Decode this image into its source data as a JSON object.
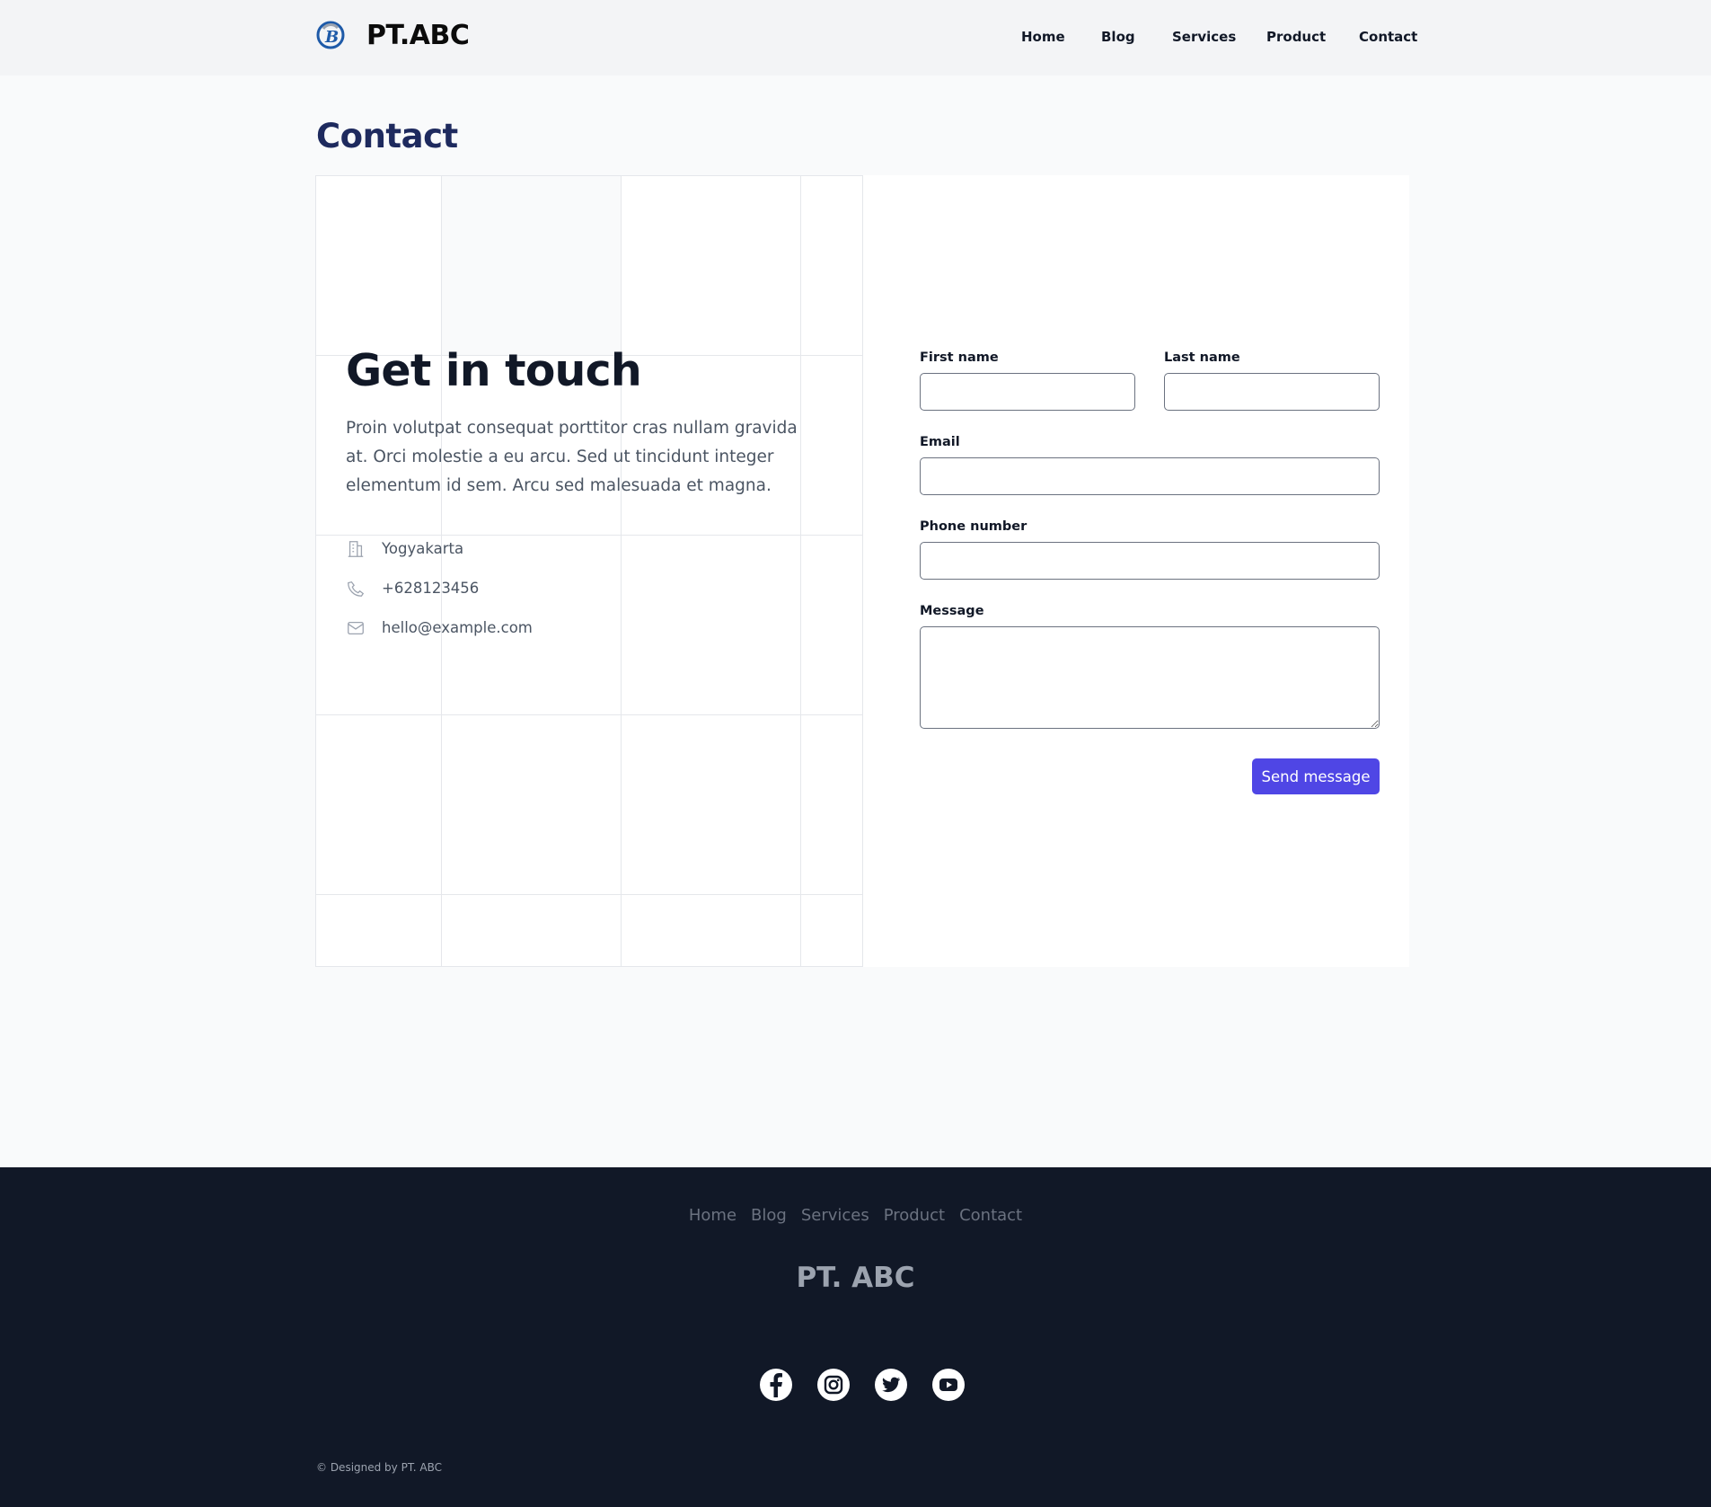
{
  "header": {
    "brand": "PT.ABC",
    "nav": [
      "Home",
      "Blog",
      "Services",
      "Product",
      "Contact"
    ]
  },
  "page": {
    "title": "Contact"
  },
  "contact_info": {
    "heading": "Get in touch",
    "body": "Proin volutpat consequat porttitor cras nullam gravida at. Orci molestie a eu arcu. Sed ut tincidunt integer elementum id sem. Arcu sed malesuada et magna.",
    "address": "Yogyakarta",
    "phone": "+628123456",
    "email": "hello@example.com",
    "icons": [
      "building-icon",
      "phone-icon",
      "envelope-icon"
    ]
  },
  "form": {
    "first_name_label": "First name",
    "first_name_value": "",
    "last_name_label": "Last name",
    "last_name_value": "",
    "email_label": "Email",
    "email_value": "",
    "phone_label": "Phone number",
    "phone_value": "",
    "message_label": "Message",
    "message_value": "",
    "submit_label": "Send message"
  },
  "footer": {
    "nav": [
      "Home",
      "Blog",
      "Services",
      "Product",
      "Contact"
    ],
    "brand": "PT. ABC",
    "social": [
      "facebook-icon",
      "instagram-icon",
      "twitter-icon",
      "youtube-icon"
    ],
    "copyright": "© Designed by PT. ABC"
  },
  "colors": {
    "accent": "#4f46e5",
    "title": "#1e2a5e",
    "footer_bg": "#111827",
    "header_bg": "#f3f4f6"
  }
}
